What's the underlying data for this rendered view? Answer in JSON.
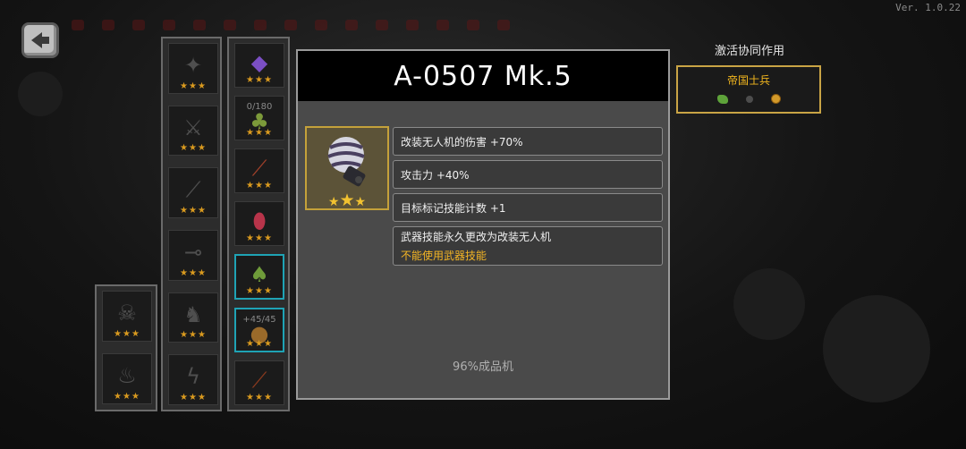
{
  "version": "Ver. 1.0.22",
  "item": {
    "title": "A-0507 Mk.5",
    "icon": "drone-module-icon",
    "stars": [
      "★",
      "★",
      "★"
    ],
    "stats": [
      {
        "text": "改装无人机的伤害 +70%"
      },
      {
        "text": "攻击力 +40%"
      },
      {
        "text": "目标标记技能计数 +1"
      },
      {
        "text": "武器技能永久更改为改装无人机",
        "warning": "不能使用武器技能"
      }
    ],
    "progress_text": "96%成品机"
  },
  "synergy": {
    "title": "激活协同作用",
    "name": "帝国士兵",
    "icons": [
      "green-bug-icon",
      "grey-dot-icon",
      "gold-coin-icon"
    ]
  },
  "inventory": {
    "col_a": [
      {
        "icon": "skull-icon",
        "stars": "★★★"
      },
      {
        "icon": "flame-icon",
        "stars": "★★★"
      }
    ],
    "col_b": [
      {
        "icon": "creature-icon",
        "stars": "★★★"
      },
      {
        "icon": "swords-icon",
        "stars": "★★★"
      },
      {
        "icon": "blade-icon",
        "stars": "★★★"
      },
      {
        "icon": "spear-icon",
        "stars": "★★★"
      },
      {
        "icon": "figure-icon",
        "stars": "★★★"
      },
      {
        "icon": "lightning-icon",
        "stars": "★★★"
      }
    ],
    "col_c": [
      {
        "icon": "purple-crystal-icon",
        "stars": "★★★",
        "counter": ""
      },
      {
        "icon": "green-gem-icon",
        "stars": "★★★",
        "counter": "0/180"
      },
      {
        "icon": "red-club-icon",
        "stars": "★★★",
        "counter": ""
      },
      {
        "icon": "red-egg-icon",
        "stars": "★★★",
        "counter": ""
      },
      {
        "icon": "green-plant-icon",
        "stars": "★★★",
        "counter": ""
      },
      {
        "icon": "brown-orb-icon",
        "stars": "★★★",
        "counter": "+45/45"
      },
      {
        "icon": "red-staff-icon",
        "stars": "★★★",
        "counter": ""
      }
    ]
  },
  "colors": {
    "accent_gold": "#c9a445",
    "warning": "#f4b524",
    "cyan_frame": "#1fa3b5"
  }
}
